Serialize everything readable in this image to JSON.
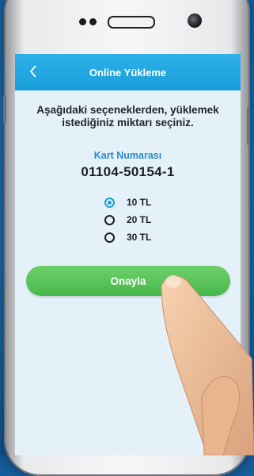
{
  "appbar": {
    "title": "Online Yükleme",
    "back_icon": "chevron-left-icon"
  },
  "instruction": "Aşağıdaki seçeneklerden, yüklemek istediğiniz miktarı seçiniz.",
  "card": {
    "label": "Kart Numarası",
    "number": "01104-50154-1"
  },
  "amounts": {
    "selected": "10 TL",
    "options": [
      {
        "label": "10 TL"
      },
      {
        "label": "20 TL"
      },
      {
        "label": "30 TL"
      }
    ]
  },
  "confirm_label": "Onayla",
  "colors": {
    "accent": "#1d9fd9",
    "confirm": "#4cbb4c",
    "screen_bg": "#e5f1f8",
    "background": "#1d74b8"
  }
}
